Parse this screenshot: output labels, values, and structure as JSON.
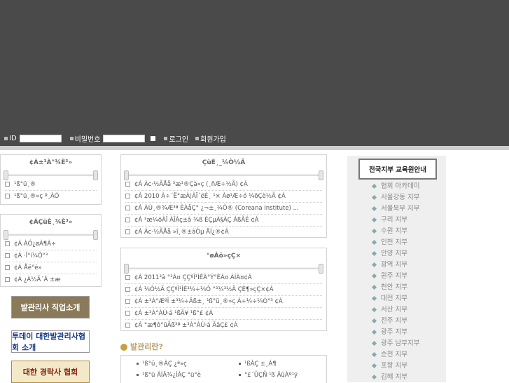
{
  "login": {
    "id_label": "ID",
    "password_label": "비밀번호",
    "login_label": "로그인",
    "join_label": "회원가입"
  },
  "left": {
    "panel1": {
      "title": "¢Á±³À°¾È³»",
      "items": [
        "¹ß°ü¸®",
        "¹ß°ü¸®»ç º¸ÀÓ"
      ]
    },
    "panel2": {
      "title": "¢ÁÇùÈ¸¾È³»",
      "items": [
        "¢Á ÀÓ¿øÁ¶Á÷",
        "¢Á ·Î°í¼Ò°³",
        "¢Á Åë°è»",
        "¢Á ¿À½Ã´Â ±æ"
      ]
    },
    "banners": {
      "b1": "발관리사 직업소개",
      "b2": "투데이 대한발관리사협회 소개",
      "b3": "대한 경락사 협회"
    }
  },
  "center": {
    "panel1": {
      "title": "ÇùÈ¸_¼Ò½Ä",
      "items": [
        "¢Á Ác·½ÃÅå ³æ¹®Çà»ç (¸ñÆ÷½Ã) ¢Á",
        "¢Á 2010 À÷´Ë°æÀ¦ÀÏ´ëÈ¸ ¹× Àø¹Æ÷ó ¼öÇè½Ã ¢Á",
        "¢Á ÀÚ¸®¾Æ³ª ÈÀåÇ° ¿¬±¸¼Ò® (Coreana Institute) ...",
        "¢Á ³æ¼öÀÎ ÀÎÀç±â ¾ß ÈÇµÀ§ÀÇ ÁßÃÉ ¢Á",
        "¢Á Ác·½ÃÅå »î¸®±âÒµ ÄÍ¿®¢Á"
      ]
    },
    "panel2": {
      "title": "°øÁö»çÇ×",
      "items": [
        "¢Á 2011³â °³Á¤ ÇÇºÎ¹ÌÈÀ°Ý°ÈÀ¤ ÁÍÀ¤¢Á",
        "¢Á ¼Ò½Ä ÇÇºÎ¹ÌÈ³¼÷¼Ò °³¼³½Ã ÇÈ¶»çÇ×¢Á",
        "¢Á ±³À°ÆºÎ ±³¼÷Ãß±¸ ¹ß°ü¸®»ç Á÷¼÷¼Ò°³ ¢Á",
        "¢Á ±³À°ÀÚ·á ¹ßÃ¥ ¹ß°£ ¢Á",
        "¢Á °æ¶ô°üÃß³ª ±³À°ÀÚ·á ÃâÇ£ ¢Á"
      ]
    },
    "what_title": "발관리란?",
    "bottom": {
      "left": [
        "¹ß°ü¸®ÀÇ ¿ª»ç",
        "¹ß°ü ÁÍÂ¾¿ÍÀÇ °ü°è"
      ],
      "right": [
        "¹ßÀÇ ±¸Á¶",
        "°£´ÜÇÑ ¹ß ÂûÀº¹ý"
      ]
    }
  },
  "sidebar": {
    "button": "전국지부 교육원안내",
    "items": [
      "협회 아카데미",
      "서울강동 지부",
      "서울북부 지부",
      "구리 지부",
      "수원 지부",
      "인천 지부",
      "안양 지부",
      "광역 지부",
      "원주 지부",
      "천안 지부",
      "대전 지부",
      "서산 지부",
      "전주 지부",
      "광주 지부",
      "광주 남부지부",
      "순천 지부",
      "포항 지부",
      "김해 지부"
    ]
  }
}
